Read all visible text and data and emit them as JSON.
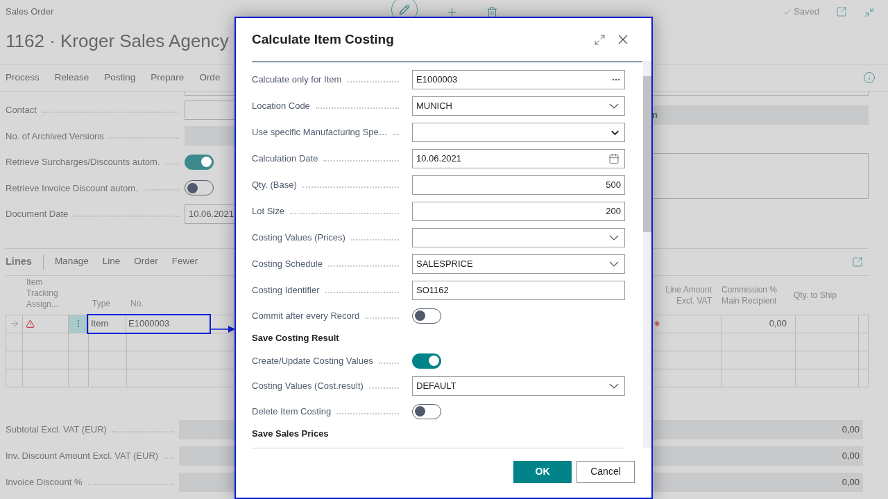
{
  "page": {
    "breadcrumb": "Sales Order",
    "title": "1162 · Kroger Sales Agency",
    "saved": "Saved"
  },
  "actions": [
    "Process",
    "Release",
    "Posting",
    "Prepare",
    "Orde"
  ],
  "header_fields": [
    {
      "label": "Contact",
      "kind": "input"
    },
    {
      "label": "No. of Archived Versions",
      "kind": "readonly"
    },
    {
      "label": "Retrieve Surcharges/Discounts autom.",
      "kind": "toggle",
      "on": true
    },
    {
      "label": "Retrieve Invoice Discount autom.",
      "kind": "toggle",
      "on": false
    },
    {
      "label": "Document Date",
      "kind": "input",
      "value": "10.06.2021"
    }
  ],
  "side_panel": {
    "status": "n"
  },
  "lines": {
    "title": "Lines",
    "actions": [
      "Manage",
      "Line",
      "Order",
      "Fewer"
    ],
    "columns": {
      "tracking": "Item Tracking Assign...",
      "type": "Type",
      "no": "No.",
      "line_amount": "Line Amount Excl. VAT",
      "commission": "Commission % Main Recipient",
      "qty_to_ship": "Qty. to Ship"
    },
    "rows": [
      {
        "selected": true,
        "warning": true,
        "required": true,
        "type": "Item",
        "no": "E1000003",
        "commission": "0,00"
      }
    ]
  },
  "totals": [
    {
      "label": "Subtotal Excl. VAT (EUR)",
      "value": "0,00"
    },
    {
      "label": "Inv. Discount Amount Excl. VAT (EUR)",
      "value": "0,00"
    },
    {
      "label": "Invoice Discount %",
      "value": "0,00"
    }
  ],
  "dialog": {
    "title": "Calculate Item Costing",
    "fields": [
      {
        "label": "Calculate only for Item",
        "kind": "lookup",
        "value": "E1000003"
      },
      {
        "label": "Location Code",
        "kind": "select",
        "value": "MUNICH"
      },
      {
        "label": "Use specific Manufacturing Spe…",
        "kind": "native_select"
      },
      {
        "label": "Calculation Date",
        "kind": "date",
        "value": "10.06.2021"
      },
      {
        "label": "Qty. (Base)",
        "kind": "number",
        "value": "500"
      },
      {
        "label": "Lot Size",
        "kind": "number",
        "value": "200"
      },
      {
        "label": "Costing Values (Prices)",
        "kind": "select"
      },
      {
        "label": "Costing Schedule",
        "kind": "select",
        "value": "SALESPRICE"
      },
      {
        "label": "Costing Identifier",
        "kind": "text",
        "value": "SO1162"
      },
      {
        "label": "Commit after every Record",
        "kind": "toggle",
        "on": false
      },
      {
        "label": "Save Costing Result",
        "kind": "heading"
      },
      {
        "label": "Create/Update Costing Values",
        "kind": "toggle",
        "on": true
      },
      {
        "label": "Costing Values (Cost.result)",
        "kind": "select",
        "value": "DEFAULT"
      },
      {
        "label": "Delete Item Costing",
        "kind": "toggle",
        "on": false
      },
      {
        "label": "Save Sales Prices",
        "kind": "heading"
      }
    ],
    "buttons": [
      {
        "label": "OK",
        "kind": "primary"
      },
      {
        "label": "Cancel",
        "kind": "secondary"
      }
    ]
  }
}
